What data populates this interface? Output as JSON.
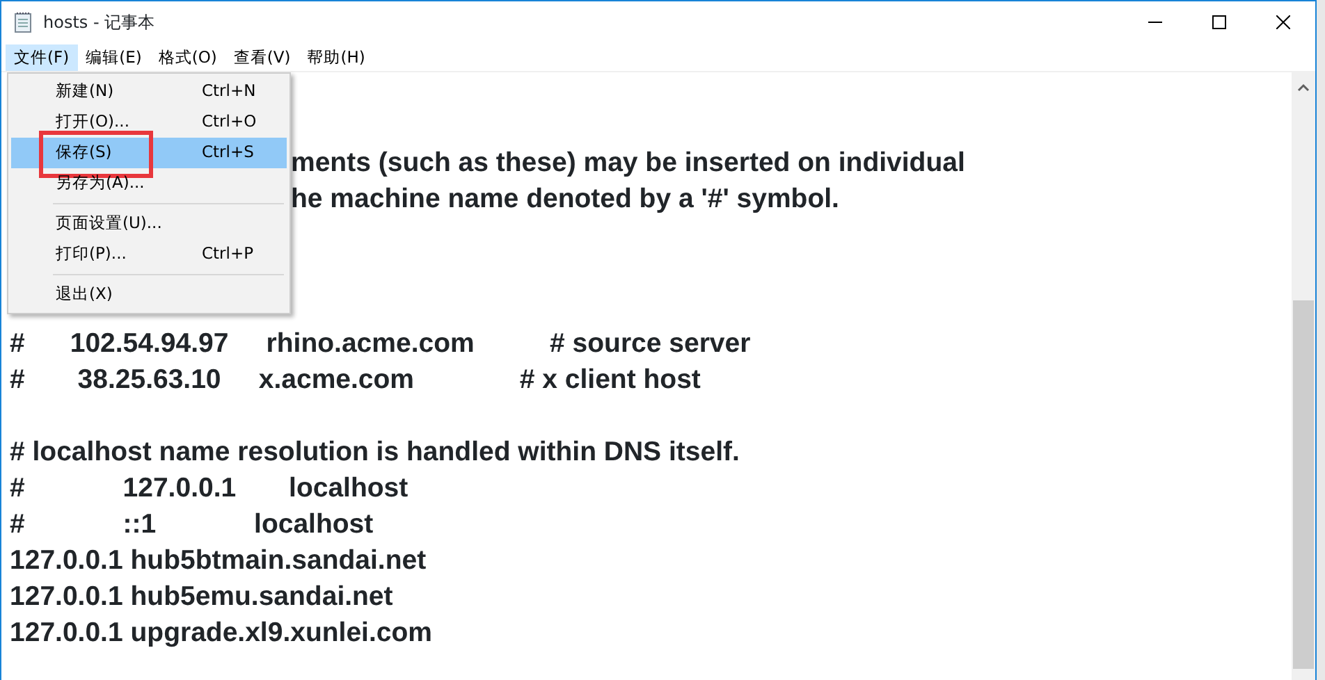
{
  "window": {
    "title": "hosts - 记事本"
  },
  "menu_bar": [
    {
      "label": "文件(F)",
      "selected": true
    },
    {
      "label": "编辑(E)",
      "selected": false
    },
    {
      "label": "格式(O)",
      "selected": false
    },
    {
      "label": "查看(V)",
      "selected": false
    },
    {
      "label": "帮助(H)",
      "selected": false
    }
  ],
  "file_menu": [
    {
      "kind": "item",
      "label": "新建(N)",
      "shortcut": "Ctrl+N",
      "selected": false,
      "outlined": false
    },
    {
      "kind": "item",
      "label": "打开(O)...",
      "shortcut": "Ctrl+O",
      "selected": false,
      "outlined": false
    },
    {
      "kind": "item",
      "label": "保存(S)",
      "shortcut": "Ctrl+S",
      "selected": true,
      "outlined": true
    },
    {
      "kind": "item",
      "label": "另存为(A)...",
      "selected": false,
      "outlined": false
    },
    {
      "kind": "separator"
    },
    {
      "kind": "item",
      "label": "页面设置(U)...",
      "selected": false,
      "outlined": false
    },
    {
      "kind": "item",
      "label": "打印(P)...",
      "shortcut": "Ctrl+P",
      "selected": false,
      "outlined": false
    },
    {
      "kind": "separator"
    },
    {
      "kind": "item",
      "label": "退出(X)",
      "selected": false,
      "outlined": false
    }
  ],
  "editor_lines": [
    {
      "kind": "hidden"
    },
    {
      "kind": "hidden"
    },
    {
      "kind": "partial",
      "text": "ments (such as these) may be inserted on individual"
    },
    {
      "kind": "partial",
      "text": "he machine name denoted by a '#' symbol."
    },
    {
      "kind": "hidden"
    },
    {
      "kind": "hidden"
    },
    {
      "kind": "hidden"
    },
    {
      "kind": "full",
      "text": "#      102.54.94.97     rhino.acme.com          # source server"
    },
    {
      "kind": "full",
      "text": "#       38.25.63.10     x.acme.com              # x client host"
    },
    {
      "kind": "blank"
    },
    {
      "kind": "full",
      "text": "# localhost name resolution is handled within DNS itself."
    },
    {
      "kind": "full",
      "text": "#             127.0.0.1       localhost"
    },
    {
      "kind": "full",
      "text": "#             ::1             localhost"
    },
    {
      "kind": "full",
      "text": "127.0.0.1 hub5btmain.sandai.net"
    },
    {
      "kind": "full",
      "text": "127.0.0.1 hub5emu.sandai.net"
    },
    {
      "kind": "full",
      "text": "127.0.0.1 upgrade.xl9.xunlei.com"
    }
  ]
}
